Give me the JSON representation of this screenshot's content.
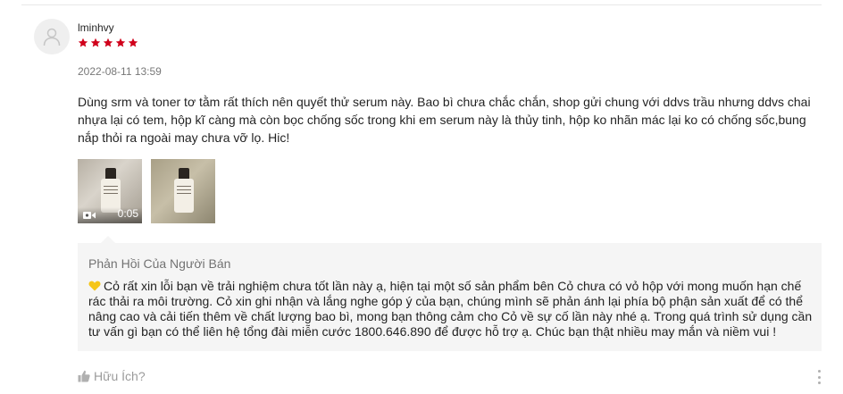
{
  "review": {
    "username": "lminhvy",
    "rating": 5,
    "rating_max": 5,
    "star_color": "#d0011b",
    "timestamp": "2022-08-11 13:59",
    "text": "Dùng srm và toner tơ tằm rất thích nên quyết thử serum này. Bao bì chưa chắc chắn, shop gửi chung với ddvs trầu nhưng ddvs chai nhựa lại có tem, hộp kĩ càng mà còn bọc chống sốc trong khi em serum này là thủy tinh, hộp ko nhãn mác lại ko có chống sốc,bung nắp thỏi ra ngoài may chưa vỡ lọ. Hic!",
    "media": [
      {
        "type": "video",
        "duration": "0:05",
        "icon": "video-camera-icon"
      },
      {
        "type": "image"
      }
    ]
  },
  "seller_reply": {
    "title": "Phản Hồi Của Người Bán",
    "icon": "yellow-heart-icon",
    "text": "Cỏ rất xin lỗi bạn về trải nghiệm chưa tốt lần này ạ, hiện tại một số sản phẩm bên Cỏ chưa có vỏ hộp với mong muốn hạn chế rác thải ra môi trường. Cỏ xin ghi nhận và lắng nghe góp ý của bạn, chúng mình sẽ phản ánh lại phía bộ phận sản xuất để có thể nâng cao và cải tiến thêm về chất lượng bao bì, mong bạn thông cảm cho Cỏ về sự cố lần này nhé ạ. Trong quá trình sử dụng cần tư vấn gì bạn có thể liên hệ tổng đài miễn cước 1800.646.890 để được hỗ trợ ạ. Chúc bạn thật nhiều may mắn và niềm vui !"
  },
  "footer": {
    "helpful_label": "Hữu Ích?",
    "helpful_icon": "thumbs-up-icon",
    "more_icon": "more-vertical-icon"
  }
}
